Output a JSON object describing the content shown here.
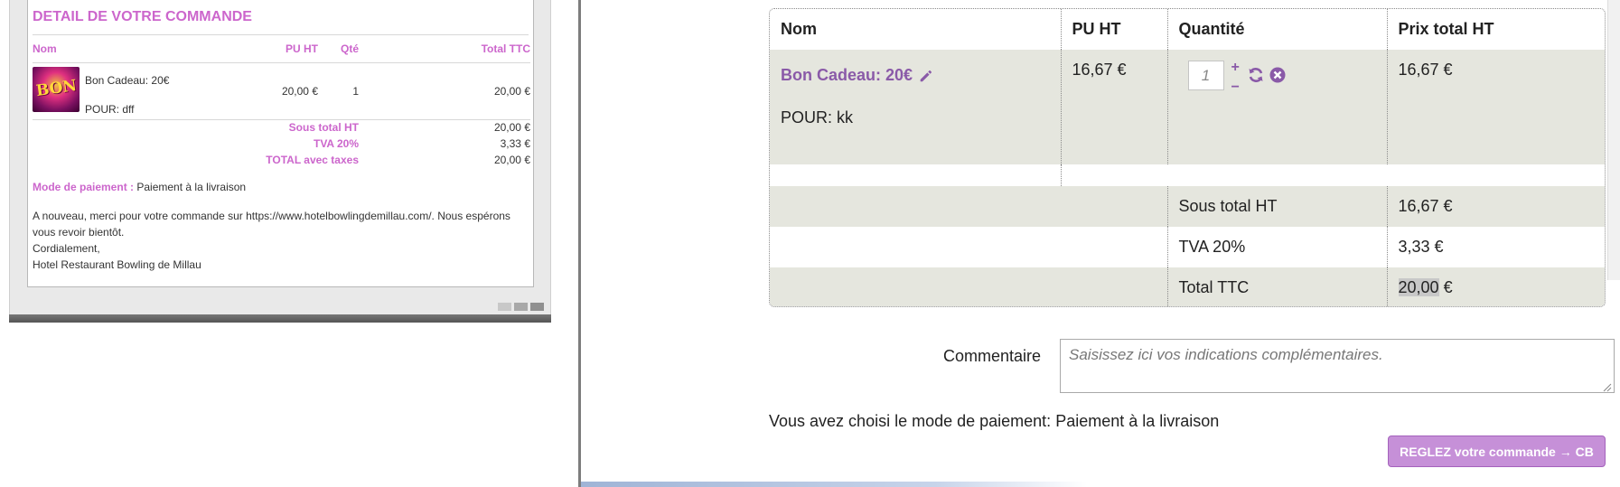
{
  "email": {
    "title": "DETAIL DE VOTRE COMMANDE",
    "columns": {
      "name": "Nom",
      "pu_ht": "PU HT",
      "qty": "Qté",
      "total_ttc": "Total TTC"
    },
    "item": {
      "thumb_text": "BON",
      "name": "Bon Cadeau: 20€",
      "for": "POUR: dff",
      "pu_ht": "20,00 €",
      "qty": "1",
      "total": "20,00 €"
    },
    "totals": [
      {
        "label": "Sous total HT",
        "value": "20,00 €"
      },
      {
        "label": "TVA 20%",
        "value": "3,33 €"
      },
      {
        "label": "TOTAL avec taxes",
        "value": "20,00 €"
      }
    ],
    "payment_label": "Mode de paiement :",
    "payment_value": "Paiement à la livraison",
    "message_1": "A nouveau, merci pour votre commande sur https://www.hotelbowlingdemillau.com/. Nous espérons vous revoir bientôt.",
    "message_2": "Cordialement,",
    "message_3": "Hotel Restaurant Bowling de Millau"
  },
  "cart": {
    "headers": {
      "name": "Nom",
      "pu_ht": "PU HT",
      "qty": "Quantité",
      "total_ht": "Prix total HT"
    },
    "item": {
      "name": "Bon Cadeau: 20€",
      "for": "POUR: kk",
      "pu_ht": "16,67 €",
      "qty": "1",
      "plus": "+",
      "minus": "−",
      "total_ht": "16,67 €"
    },
    "totals": {
      "subtotal_label": "Sous total HT",
      "subtotal_value": "16,67 €",
      "tva_label": "TVA 20%",
      "tva_value": "3,33 €",
      "ttc_label": "Total TTC",
      "ttc_amount": "20,00",
      "ttc_currency": "€"
    },
    "accent_color": "#8a5aa8",
    "row_color": "#e5e6de"
  },
  "comment": {
    "label": "Commentaire",
    "placeholder": "Saisissez ici vos indications complémentaires."
  },
  "payment_choice": "Vous avez choisi le mode de paiement: Paiement à la livraison",
  "pay_button": "REGLEZ votre commande → CB",
  "icons": [
    "pencil-icon",
    "refresh-icon",
    "remove-icon",
    "resize-handle-icon"
  ]
}
